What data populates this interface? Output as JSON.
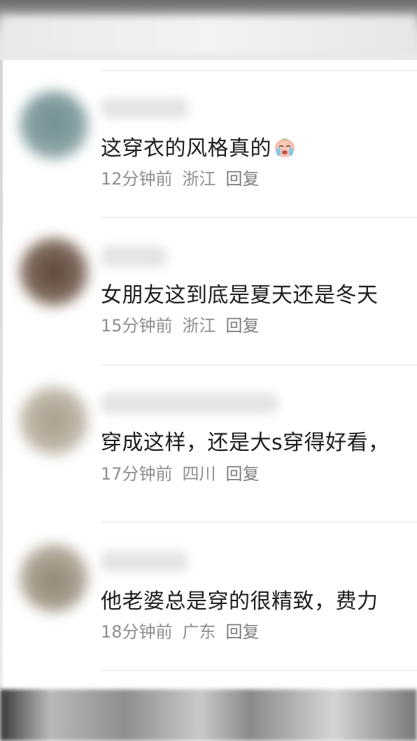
{
  "comments": [
    {
      "text": "这穿衣的风格真的",
      "emoji": "crying-face-emoji",
      "time": "12分钟前",
      "location": "浙江",
      "reply": "回复",
      "avatar_color": "#7f9a9b"
    },
    {
      "text": "女朋友这到底是夏天还是冬天",
      "time": "15分钟前",
      "location": "浙江",
      "reply": "回复",
      "avatar_color": "#7a6458"
    },
    {
      "text": "穿成这样，还是大s穿得好看，",
      "time": "17分钟前",
      "location": "四川",
      "reply": "回复",
      "avatar_color": "#b7ae9c"
    },
    {
      "text": "他老婆总是穿的很精致，费力",
      "time": "18分钟前",
      "location": "广东",
      "reply": "回复",
      "avatar_color": "#a49a88"
    }
  ]
}
